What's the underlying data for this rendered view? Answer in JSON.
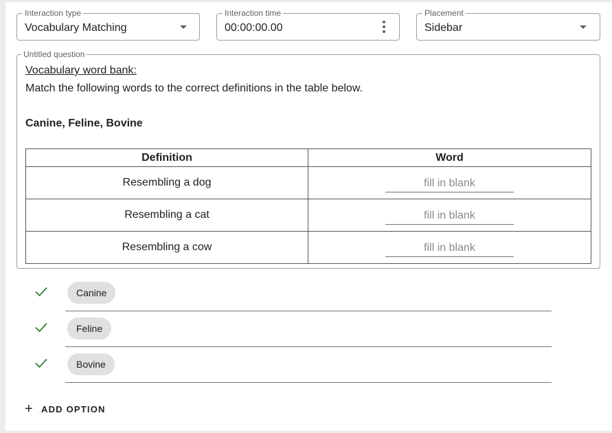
{
  "header": {
    "interaction_type": {
      "legend": "Interaction type",
      "value": "Vocabulary Matching"
    },
    "interaction_time": {
      "legend": "Interaction time",
      "value": "00:00:00.00"
    },
    "placement": {
      "legend": "Placement",
      "value": "Sidebar"
    }
  },
  "question": {
    "legend": "Untitled question",
    "title": "Vocabulary word bank:",
    "instruction": "Match the following words to the correct definitions in the table below.",
    "word_list": "Canine, Feline, Bovine",
    "table": {
      "headers": [
        "Definition",
        "Word"
      ],
      "rows": [
        {
          "definition": "Resembling a dog",
          "blank": "fill in blank"
        },
        {
          "definition": "Resembling a cat",
          "blank": "fill in blank"
        },
        {
          "definition": "Resembling a cow",
          "blank": "fill in blank"
        }
      ]
    }
  },
  "options": [
    {
      "label": "Canine",
      "correct": true
    },
    {
      "label": "Feline",
      "correct": true
    },
    {
      "label": "Bovine",
      "correct": true
    }
  ],
  "add_option_label": "ADD OPTION",
  "colors": {
    "check": "#2e7d32",
    "chip": "#e0e0e0",
    "border": "#9e9e9e"
  }
}
